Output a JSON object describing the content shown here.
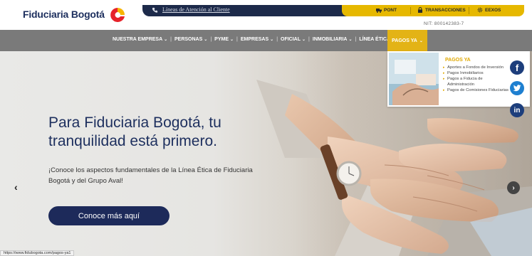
{
  "header": {
    "logo_text": "Fiduciaria Bogotá",
    "topbar_link": "Líneas de Atención al Cliente",
    "buttons": {
      "pont": "PONT",
      "transacciones": "TRANSACCIONES",
      "eexos": "EEXOS"
    },
    "nit": "NIT: 800142383-7"
  },
  "nav": {
    "items": [
      {
        "label": "NUESTRA EMPRESA"
      },
      {
        "label": "PERSONAS"
      },
      {
        "label": "PYME"
      },
      {
        "label": "EMPRESAS"
      },
      {
        "label": "OFICIAL"
      },
      {
        "label": "INMOBILIARIA"
      },
      {
        "label": "LÍNEA ÉTICA"
      }
    ],
    "active": "PAGOS YA",
    "separator": "|",
    "caret": "⌄"
  },
  "dropdown": {
    "title": "PAGOS YA",
    "items": [
      "Aportes a Fondos de Inversión",
      "Pagos Inmobiliarios",
      "Pagos a Fiducia de Administración",
      "Pagos de Comisiones Fiduciarias"
    ]
  },
  "hero": {
    "title": "Para Fiduciaria Bogotá, tu tranquilidad está primero.",
    "subtitle": "¡Conoce los aspectos fundamentales de la Línea Ética de Fiduciaria Bogotá y del Grupo Aval!",
    "cta": "Conoce más aquí",
    "prev": "‹",
    "next": "›"
  },
  "social": {
    "facebook": "f",
    "linkedin": "in"
  },
  "status_url": "https://www.fidubogota.com/pagos-ya1",
  "colors": {
    "navy": "#1d2f5e",
    "gold": "#e3b316",
    "nav_gray": "#7a7a7a"
  }
}
